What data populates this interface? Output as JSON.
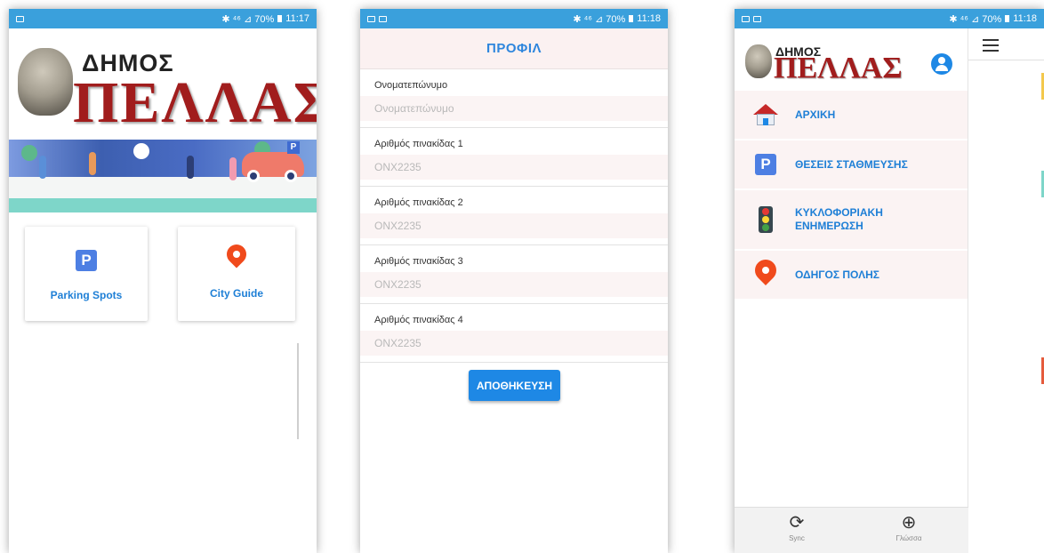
{
  "screens": {
    "home": {
      "status": {
        "left_icons": [
          "notification-icon"
        ],
        "right": "✱ ⁴⁶ ⊿ 70%",
        "time": "11:17"
      },
      "logo": {
        "small": "ΔΗΜΟΣ",
        "big": "ΠΕΛΛΑΣ"
      },
      "cards": [
        {
          "label": "Parking Spots",
          "icon": "parking-icon",
          "icon_text": "P",
          "color": "#4d7fe3"
        },
        {
          "label": "City Guide",
          "icon": "location-pin-icon",
          "color": "#f04a1c"
        }
      ]
    },
    "profile": {
      "status": {
        "left_icons": [
          "image-icon",
          "mail-icon"
        ],
        "right": "✱ ⁴⁶ ⊿ 70%",
        "time": "11:18"
      },
      "title": "ΠΡΟΦΙΛ",
      "fields": [
        {
          "label": "Ονοματεπώνυμο",
          "placeholder": "Ονοματεπώνυμο"
        },
        {
          "label": "Αριθμός πινακίδας 1",
          "placeholder": "ONX2235"
        },
        {
          "label": "Αριθμός πινακίδας 2",
          "placeholder": "ONX2235"
        },
        {
          "label": "Αριθμός πινακίδας 3",
          "placeholder": "ONX2235"
        },
        {
          "label": "Αριθμός πινακίδας 4",
          "placeholder": "ONX2235"
        }
      ],
      "save_label": "ΑΠΟΘΗΚΕΥΣΗ"
    },
    "menu": {
      "status": {
        "left_icons": [
          "image-icon",
          "mail-icon"
        ],
        "right": "✱ ⁴⁶ ⊿ 70%",
        "time": "11:18"
      },
      "logo": {
        "small": "ΔΗΜΟΣ",
        "big": "ΠΕΛΛΑΣ"
      },
      "items": [
        {
          "label": "ΑΡΧΙΚΗ",
          "icon": "home-icon"
        },
        {
          "label": "ΘΕΣΕΙΣ ΣΤΑΘΜΕΥΣΗΣ",
          "icon": "parking-icon",
          "icon_text": "P"
        },
        {
          "label": "ΚΥΚΛΟΦΟΡΙΑΚΗ ΕΝΗΜΕΡΩΣΗ",
          "icon": "traffic-light-icon"
        },
        {
          "label": "ΟΔΗΓΟΣ ΠΟΛΗΣ",
          "icon": "location-pin-icon"
        }
      ],
      "footer": [
        {
          "label": "Sync",
          "icon": "sync-icon",
          "glyph": "⟳"
        },
        {
          "label": "Γλώσσα",
          "icon": "globe-icon",
          "glyph": "⊕"
        }
      ],
      "accent": "#1e7fd6"
    }
  }
}
